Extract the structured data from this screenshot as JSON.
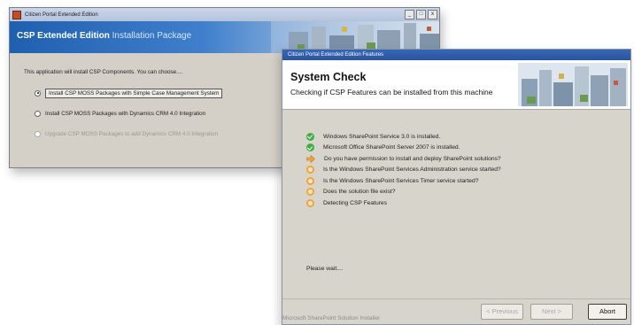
{
  "installer_window": {
    "title": "Citizen Portal Extended Edition",
    "controls": [
      "_",
      "□",
      "x"
    ],
    "banner_title_bold": "CSP Extended Edition",
    "banner_title_rest": "Installation Package",
    "intro_text": "This application will install CSP Components. You can choose....",
    "options": [
      {
        "label": "Install CSP MOSS Packages with Simple Case Management System",
        "selected": true,
        "enabled": true
      },
      {
        "label": "Install CSP MOSS Packages with Dynamics CRM 4.0 Integration",
        "selected": false,
        "enabled": true
      },
      {
        "label": "Upgrade CSP MOSS Packages to add Dynamics CRM 4.0 Integration",
        "selected": false,
        "enabled": false
      }
    ],
    "banner_color": "#2a6bc0"
  },
  "features_window": {
    "title": "Citizen Portal Extended Edition Features",
    "heading": "System Check",
    "subheading": "Checking if CSP Features can be installed from this machine",
    "checks": [
      {
        "text": "Windows SharePoint Service 3.0 is installed.",
        "status": "success-icon"
      },
      {
        "text": "Microsoft Office SharePoint Server 2007 is installed.",
        "status": "success-icon"
      },
      {
        "text": "Do you have permission to install and deploy SharePoint solutions?",
        "status": "arrow-icon"
      },
      {
        "text": "Is the Windows SharePoint Services Administration service started?",
        "status": "pending-icon"
      },
      {
        "text": "Is the Windows SharePoint Services Timer service started?",
        "status": "pending-icon"
      },
      {
        "text": "Does the solution file exist?",
        "status": "pending-icon"
      },
      {
        "text": "Detecting CSP Features",
        "status": "pending-icon"
      }
    ],
    "wait_text": "Please wait....",
    "footer_brand": "Microsoft SharePoint Solution Installer",
    "buttons": {
      "previous": "< Previous",
      "next": "Next >",
      "abort": "Abort"
    },
    "status_colors": {
      "success": "#3fae49",
      "pending": "#f2a23a"
    }
  }
}
